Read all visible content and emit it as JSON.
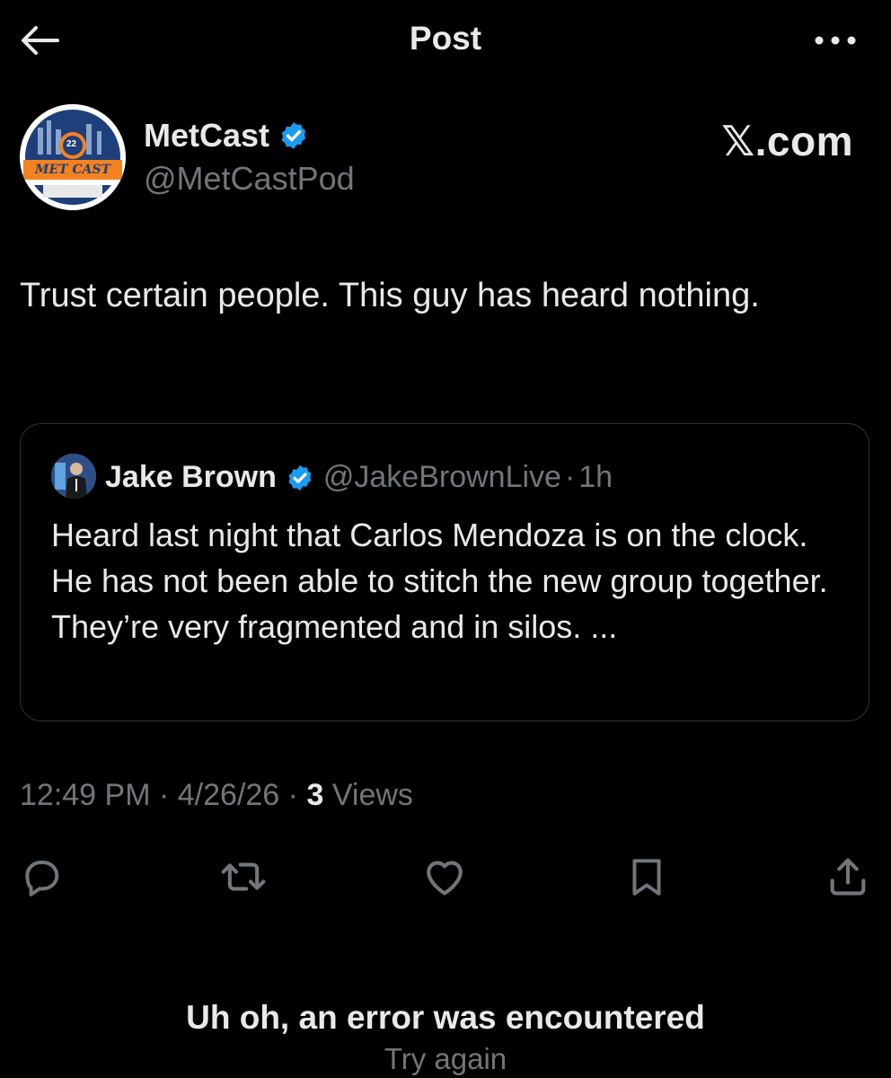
{
  "header": {
    "title": "Post",
    "back_icon": "arrow-left-icon",
    "more_icon": "more-horizontal-icon"
  },
  "author": {
    "name": "MetCast",
    "handle": "@MetCastPod",
    "verified": true,
    "avatar_text": "MET CAST",
    "avatar_badge": "22"
  },
  "watermark": "𝕏.com",
  "post": {
    "text": "Trust certain people. This guy has heard nothing."
  },
  "quote": {
    "name": "Jake Brown",
    "handle": "@JakeBrownLive",
    "separator": "·",
    "time": "1h",
    "text": "Heard last night that Carlos Mendoza is on the clock. He has not been able to stitch the new group together. They’re very fragmented and in silos. ..."
  },
  "meta": {
    "time": "12:49 PM",
    "sep1": "·",
    "date": "4/26/26",
    "sep2": "·",
    "views_count": "3",
    "views_label": "Views"
  },
  "actions": [
    {
      "icon": "reply-icon"
    },
    {
      "icon": "repost-icon"
    },
    {
      "icon": "like-icon"
    },
    {
      "icon": "bookmark-icon"
    },
    {
      "icon": "share-icon"
    }
  ],
  "error": {
    "title": "Uh oh, an error was encountered",
    "retry_label": "Try again"
  },
  "colors": {
    "background": "#000000",
    "text_primary": "#e7e9ea",
    "text_secondary": "#71767b",
    "verified_blue": "#1d9bf0",
    "border": "#2f3336"
  }
}
